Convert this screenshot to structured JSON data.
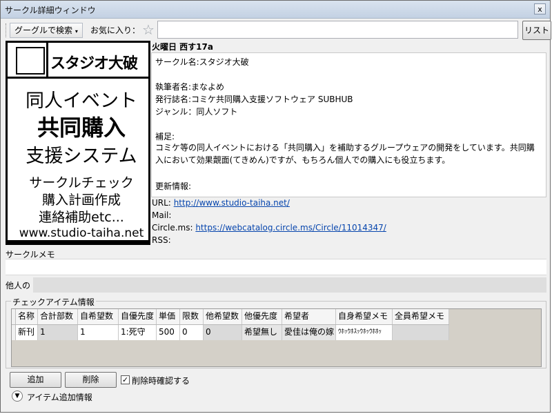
{
  "window": {
    "title": "サークル詳細ウィンドウ",
    "close_label": "x"
  },
  "toolbar": {
    "google_search_label": "グーグルで検索",
    "favorite_label": "お気に入り：",
    "search_value": "",
    "list_button_label": "リスト"
  },
  "banner": {
    "studio_name": "スタジオ大破",
    "line1": "同人イベント",
    "line2": "共同購入",
    "line3": "支援システム",
    "line4": "サークルチェック",
    "line5": "購入計画作成",
    "line6": "連絡補助etc...",
    "url": "www.studio-taiha.net"
  },
  "info": {
    "location": "火曜日 西す17a",
    "circle_name": "サークル名:スタジオ大破",
    "author": "執筆者名:まなよめ",
    "publication": "発行誌名:コミケ共同購入支援ソフトウェア SUBHUB",
    "genre": "ジャンル：同人ソフト",
    "note_label": "補足:",
    "note_text": "コミケ等の同人イベントにおける「共同購入」を補助するグループウェアの開発をしています。共同購入において効果覿面(てきめん)ですが、もちろん個人での購入にも役立ちます。",
    "update_label": "更新情報:"
  },
  "links": {
    "url_label": "URL:",
    "url_value": "http://www.studio-taiha.net/",
    "mail_label": "Mail:",
    "circlems_label": "Circle.ms:",
    "circlems_value": "https://webcatalog.circle.ms/Circle/11014347/",
    "rss_label": "RSS:"
  },
  "memo": {
    "label": "サークルメモ",
    "value": ""
  },
  "others": {
    "label": "他人の",
    "value": ""
  },
  "items": {
    "group_title": "チェックアイテム情報",
    "columns": [
      "名称",
      "合計部数",
      "自希望数",
      "自優先度",
      "単価",
      "限数",
      "他希望数",
      "他優先度",
      "希望者",
      "自身希望メモ",
      "全員希望メモ"
    ],
    "rows": [
      [
        "新刊",
        "1",
        "1",
        "1:死守",
        "500",
        "0",
        "0",
        "希望無し",
        "愛佳は俺の嫁",
        "ｳﾎｯｳﾎｽｯｳﾎｯｳﾎﾎｯ",
        ""
      ]
    ]
  },
  "buttons": {
    "add_label": "追加",
    "delete_label": "削除",
    "confirm_label": "削除時確認する",
    "confirm_checked": true
  },
  "expand": {
    "label": "アイテム追加情報"
  }
}
